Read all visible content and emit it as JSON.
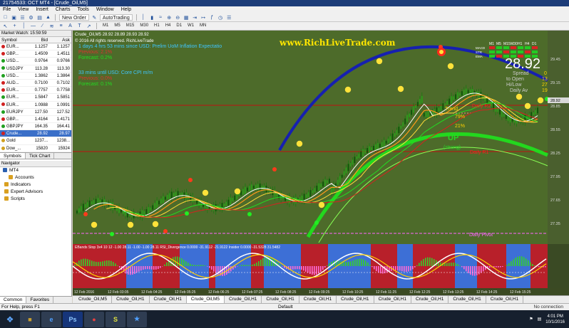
{
  "window": {
    "title": "21754533: OCT MT4 - [Crude_Oil,M5]"
  },
  "menu": [
    "File",
    "View",
    "Insert",
    "Charts",
    "Tools",
    "Window",
    "Help"
  ],
  "toolbar": {
    "new_order_label": "New Order",
    "autotrading_label": "AutoTrading",
    "timeframes": [
      "M1",
      "M5",
      "M15",
      "M30",
      "H1",
      "H4",
      "D1",
      "W1",
      "MN"
    ]
  },
  "market_watch": {
    "title": "Market Watch: 15:59:59",
    "headers": {
      "symbol": "Symbol",
      "bid": "Bid",
      "ask": "Ask"
    },
    "rows": [
      {
        "symbol": "EUR...",
        "bid": "1.1257",
        "ask": "1.1257",
        "color": "#d02020"
      },
      {
        "symbol": "GBP...",
        "bid": "1.4509",
        "ask": "1.4511",
        "color": "#d02020"
      },
      {
        "symbol": "USD...",
        "bid": "0.9764",
        "ask": "0.9766",
        "color": "#20a020"
      },
      {
        "symbol": "USDJPY",
        "bid": "113.28",
        "ask": "113.30",
        "color": "#20a020"
      },
      {
        "symbol": "USD...",
        "bid": "1.3862",
        "ask": "1.3864",
        "color": "#20a020"
      },
      {
        "symbol": "AUD...",
        "bid": "0.7100",
        "ask": "0.7102",
        "color": "#d02020"
      },
      {
        "symbol": "EUR...",
        "bid": "0.7757",
        "ask": "0.7758",
        "color": "#d02020"
      },
      {
        "symbol": "EUR...",
        "bid": "1.5847",
        "ask": "1.5851",
        "color": "#20a020"
      },
      {
        "symbol": "EUR...",
        "bid": "1.0988",
        "ask": "1.0991",
        "color": "#d02020"
      },
      {
        "symbol": "EURJPY",
        "bid": "127.50",
        "ask": "127.52",
        "color": "#20a020"
      },
      {
        "symbol": "GBP...",
        "bid": "1.4164",
        "ask": "1.4171",
        "color": "#d02020"
      },
      {
        "symbol": "GBPJPY",
        "bid": "164.35",
        "ask": "164.41",
        "color": "#20a020"
      },
      {
        "symbol": "Crude...",
        "bid": "28.92",
        "ask": "28.97",
        "color": "#d02020",
        "selected": true
      },
      {
        "symbol": "Gold",
        "bid": "1237...",
        "ask": "1238...",
        "color": "#d0a020"
      },
      {
        "symbol": "Dow_...",
        "bid": "15820",
        "ask": "15924",
        "color": "#d0a020"
      }
    ],
    "tabs": [
      "Symbols",
      "Tick Chart"
    ]
  },
  "navigator": {
    "title": "Navigator",
    "items": [
      "MT4",
      "Accounts",
      "Indicators",
      "Expert Advisors",
      "Scripts"
    ]
  },
  "left_tabs": [
    "Common",
    "Favorites"
  ],
  "chart": {
    "symbol_header": "Crude_Oil,M5  28.92 28.89 28.93 28.92",
    "copyright": "© 2016 All rights reserved. RichLiveTrade",
    "news1": "1 days 4 hrs 53 mins since USD: Prelim UoM Inflation Expectatio",
    "previous1": "Previous: 2.1%",
    "forecast1": "Forecast: 0.2%",
    "news2": "33 mins until USD: Core CPI m/m",
    "previous2": "Previous: 0.0%",
    "forecast2": "Forecast: 0.1%",
    "watermark": "www.RichLiveTrade.com",
    "price_big": "28.92",
    "spread_label": "Spread",
    "spread_value": "0",
    "candle_open_label": "to Open",
    "candle_open_value": "13",
    "high_low_label": "Hi/Low",
    "high_low_value": "27",
    "daily_label": "Daily Av",
    "daily_value": "19",
    "trend_label": "Trend",
    "pct1": "79%",
    "pct2": "21%",
    "direction": "UP",
    "strength": "(strong)",
    "daily_r1": "Daily R1",
    "daily_r2": "Daily R2",
    "daily_pivot": "Daily Pivot",
    "mtf_tf": [
      "M1",
      "M5",
      "M15",
      "M30",
      "H1",
      "H4",
      "D1"
    ],
    "mtf_rows": [
      "MACD",
      "STR",
      "EMA"
    ],
    "price_scale": [
      "29.45",
      "29.15",
      "28.85",
      "28.55",
      "28.25",
      "27.95",
      "27.65",
      "27.35"
    ],
    "subwindow_header": "EBands Stop 3x4  10  12  -1.00 28.11 -1.00 -1.00 28.11  RSI_Divergence  0.0000 -31.9112 -21.9122  Insider 0.0000 -31.5328  31.5482",
    "time_labels": [
      "12 Feb 2016",
      "12 Feb 03:05",
      "12 Feb 04:25",
      "12 Feb 05:25",
      "12 Feb 06:25",
      "12 Feb 07:25",
      "12 Feb 08:25",
      "12 Feb 09:25",
      "12 Feb 10:25",
      "12 Feb 11:25",
      "12 Feb 12:25",
      "12 Feb 13:25",
      "12 Feb 14:25",
      "12 Feb 15:25"
    ],
    "colors": {
      "bg": "#4d6b2a",
      "sub_red": "#b8202a",
      "sub_blue": "#3d6fd6",
      "candle": "#2b9a1a",
      "resistance": "#c01010",
      "arc_green": "#23d81e",
      "arc_blue": "#1620b0"
    }
  },
  "chart_tabs": [
    "Crude_Oil,M5",
    "Crude_Oil,H1",
    "Crude_Oil,H1",
    "Crude_Oil,M5",
    "Crude_Oil,H1",
    "Crude_Oil,H1",
    "Crude_Oil,H1",
    "Crude_Oil,H1",
    "Crude_Oil,H1",
    "Crude_Oil,H1",
    "Crude_Oil,H1",
    "Crude_Oil,H1"
  ],
  "active_chart_tab": 3,
  "status": {
    "help": "For Help, press F1",
    "profile": "Default",
    "connection": "No connection"
  },
  "taskbar": {
    "time": "4:01 PM",
    "date": "10/1/2016"
  }
}
